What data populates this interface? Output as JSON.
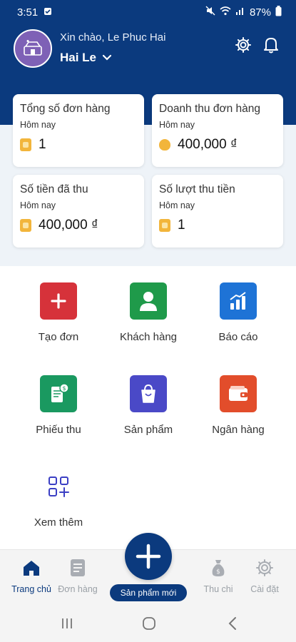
{
  "status_bar": {
    "time": "3:51",
    "battery": "87%"
  },
  "header": {
    "greeting": "Xin chào, Le Phuc Hai",
    "user_name": "Hai Le"
  },
  "stats": [
    {
      "title": "Tổng số đơn hàng",
      "period": "Hôm nay",
      "value": "1"
    },
    {
      "title": "Doanh thu đơn hàng",
      "period": "Hôm nay",
      "value": "400,000 ₫"
    },
    {
      "title": "Số tiền đã thu",
      "period": "Hôm nay",
      "value": "400,000 ₫"
    },
    {
      "title": "Số lượt thu tiền",
      "period": "Hôm nay",
      "value": "1"
    }
  ],
  "menu": [
    {
      "label": "Tạo đơn",
      "icon": "add-order-icon",
      "color": "#d6323a"
    },
    {
      "label": "Khách hàng",
      "icon": "customer-icon",
      "color": "#1f9a4a"
    },
    {
      "label": "Báo cáo",
      "icon": "report-chart-icon",
      "color": "#1e73d6"
    },
    {
      "label": "Phiếu thu",
      "icon": "receipt-icon",
      "color": "#1a9960"
    },
    {
      "label": "Sản phẩm",
      "icon": "shopping-bag-icon",
      "color": "#4a49c7"
    },
    {
      "label": "Ngân hàng",
      "icon": "wallet-icon",
      "color": "#e24d2b"
    },
    {
      "label": "Xem thêm",
      "icon": "more-apps-icon",
      "color": "#3b3fc4"
    }
  ],
  "bottom_nav": {
    "home": "Trang chủ",
    "orders": "Đơn hàng",
    "new_product": "Sản phẩm mới",
    "expenses": "Thu chi",
    "settings": "Cài đặt"
  },
  "colors": {
    "primary": "#0b3a7e",
    "accent_gold": "#f2b53b",
    "inactive": "#9aa0a6"
  }
}
